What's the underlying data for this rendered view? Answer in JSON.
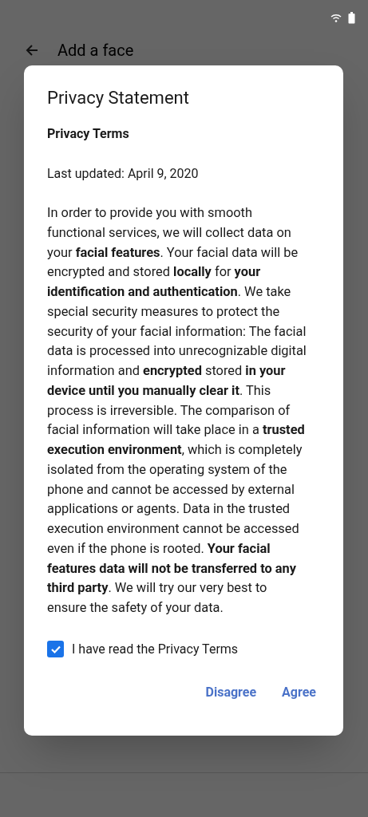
{
  "page": {
    "title": "Add a face"
  },
  "dialog": {
    "title": "Privacy Statement",
    "heading": "Privacy Terms",
    "updated": "Last updated: April 9, 2020",
    "body": "In order to provide you with smooth functional services, we will collect data on your **facial features**. Your facial data will be encrypted and stored **locally** for **your identification and authentication**. We take special security measures to protect the security of your facial information: The facial data is processed into unrecognizable digital information and **encrypted** stored **in your device until you manually clear it**. This process is irreversible. The comparison of facial information will take place in a **trusted execution environment**, which is completely isolated from the operating system of the phone and cannot be accessed by external applications or agents. Data in the trusted execution environment cannot be accessed even if the phone is rooted. **Your facial features data will not be transferred to any third party**. We will try our very best to ensure the safety of your data.",
    "consent": {
      "label": "I have read the Privacy Terms",
      "checked": true
    },
    "buttons": [
      "Disagree",
      "Agree"
    ]
  }
}
